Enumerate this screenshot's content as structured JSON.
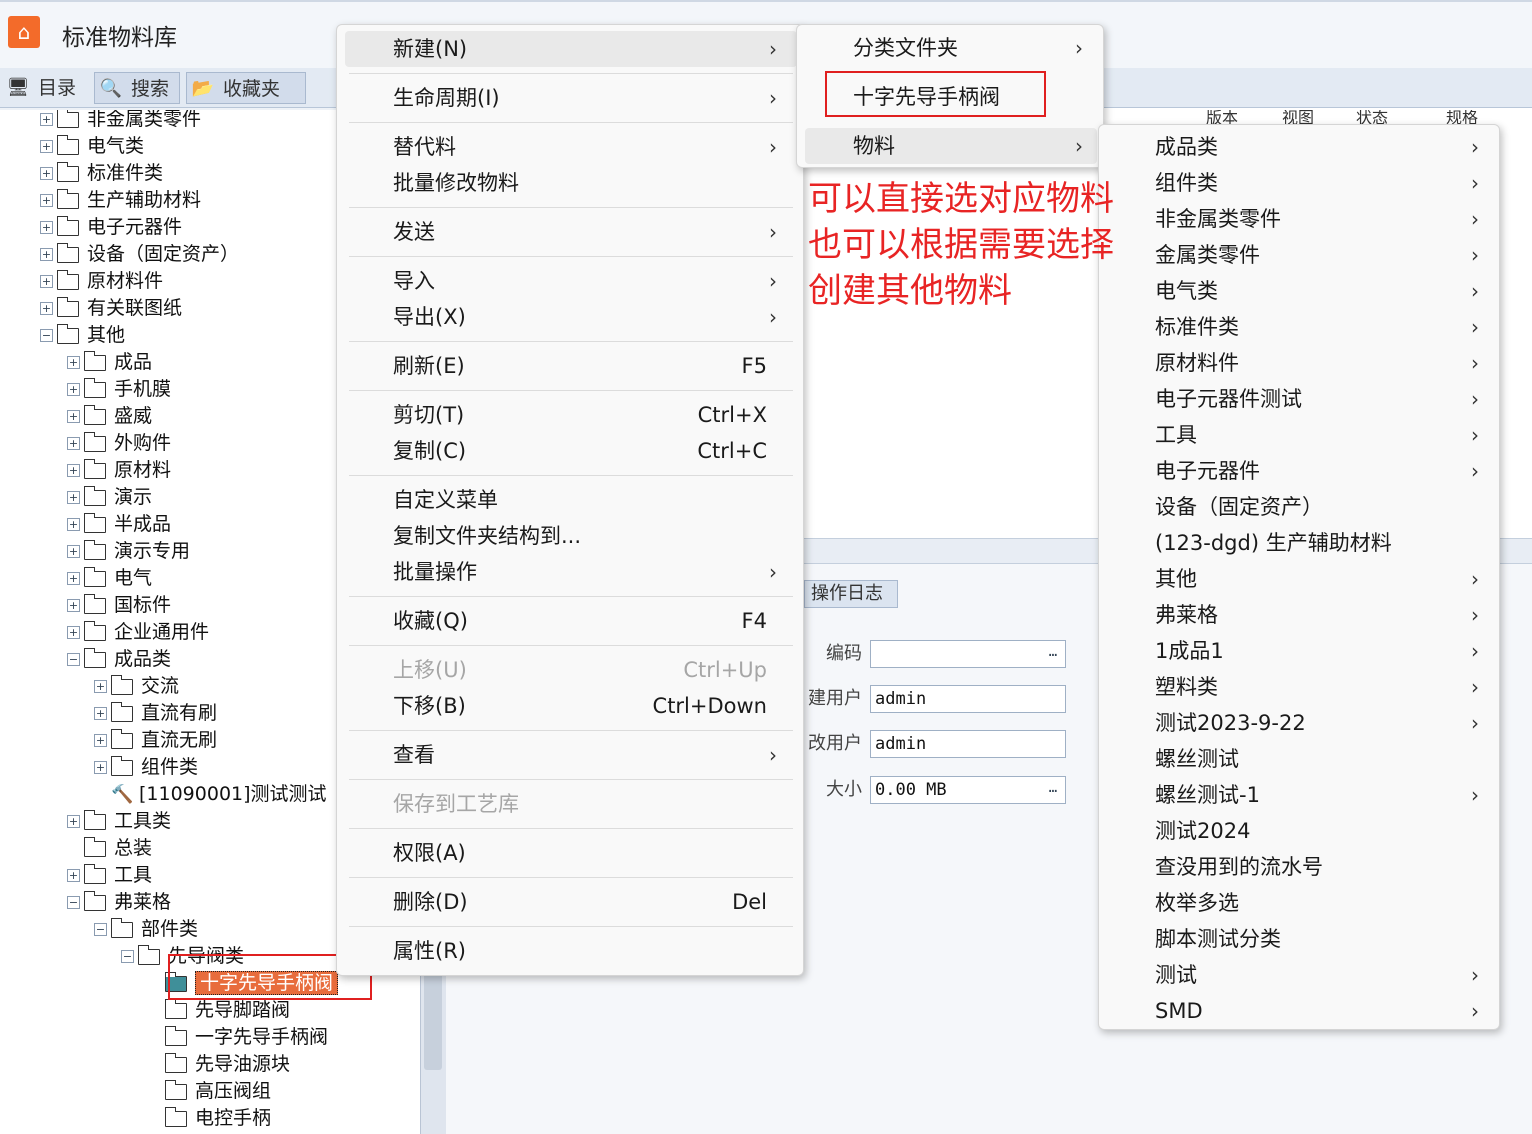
{
  "app": {
    "title": "标准物料库",
    "logo_icon": "home-icon",
    "accent": "#f36b2a"
  },
  "left_tabs": [
    {
      "label": "目录",
      "icon": "monitor-icon"
    },
    {
      "label": "搜索",
      "icon": "search-icon"
    },
    {
      "label": "收藏夹",
      "icon": "folder-star-icon"
    }
  ],
  "tree": [
    {
      "label": "非金属类零件",
      "level": 0,
      "type": "folder",
      "expander": "+"
    },
    {
      "label": "电气类",
      "level": 0,
      "type": "folder",
      "expander": "+"
    },
    {
      "label": "标准件类",
      "level": 0,
      "type": "folder",
      "expander": "+"
    },
    {
      "label": "生产辅助材料",
      "level": 0,
      "type": "folder",
      "expander": "+"
    },
    {
      "label": "电子元器件",
      "level": 0,
      "type": "folder",
      "expander": "+"
    },
    {
      "label": "设备（固定资产）",
      "level": 0,
      "type": "folder",
      "expander": "+"
    },
    {
      "label": "原材料件",
      "level": 0,
      "type": "folder",
      "expander": "+"
    },
    {
      "label": "有关联图纸",
      "level": 0,
      "type": "folder",
      "expander": "+"
    },
    {
      "label": "其他",
      "level": 0,
      "type": "folder",
      "expander": "-"
    },
    {
      "label": "成品",
      "level": 1,
      "type": "folder",
      "expander": "+"
    },
    {
      "label": "手机膜",
      "level": 1,
      "type": "folder",
      "expander": "+"
    },
    {
      "label": "盛威",
      "level": 1,
      "type": "folder",
      "expander": "+"
    },
    {
      "label": "外购件",
      "level": 1,
      "type": "folder",
      "expander": "+"
    },
    {
      "label": "原材料",
      "level": 1,
      "type": "folder",
      "expander": "+"
    },
    {
      "label": "演示",
      "level": 1,
      "type": "folder",
      "expander": "+"
    },
    {
      "label": "半成品",
      "level": 1,
      "type": "folder",
      "expander": "+"
    },
    {
      "label": "演示专用",
      "level": 1,
      "type": "folder",
      "expander": "+"
    },
    {
      "label": "电气",
      "level": 1,
      "type": "folder",
      "expander": "+"
    },
    {
      "label": "国标件",
      "level": 1,
      "type": "folder",
      "expander": "+"
    },
    {
      "label": "企业通用件",
      "level": 1,
      "type": "folder",
      "expander": "+"
    },
    {
      "label": "成品类",
      "level": 1,
      "type": "folder",
      "expander": "-"
    },
    {
      "label": "交流",
      "level": 2,
      "type": "folder",
      "expander": "+"
    },
    {
      "label": "直流有刷",
      "level": 2,
      "type": "folder",
      "expander": "+"
    },
    {
      "label": "直流无刷",
      "level": 2,
      "type": "folder",
      "expander": "+"
    },
    {
      "label": "组件类",
      "level": 2,
      "type": "folder",
      "expander": "+"
    },
    {
      "label": "[11090001]测试测试",
      "level": 2,
      "type": "item",
      "expander": ""
    },
    {
      "label": "工具类",
      "level": 1,
      "type": "folder",
      "expander": "+"
    },
    {
      "label": "总装",
      "level": 1,
      "type": "folder",
      "expander": ""
    },
    {
      "label": "工具",
      "level": 1,
      "type": "folder",
      "expander": "+"
    },
    {
      "label": "弗莱格",
      "level": 1,
      "type": "folder",
      "expander": "-"
    },
    {
      "label": "部件类",
      "level": 2,
      "type": "folder",
      "expander": "-"
    },
    {
      "label": "先导阀类",
      "level": 3,
      "type": "folder",
      "expander": "-"
    },
    {
      "label": "十字先导手柄阀",
      "level": 4,
      "type": "folder",
      "expander": "",
      "selected": true
    },
    {
      "label": "先导脚踏阀",
      "level": 4,
      "type": "folder",
      "expander": ""
    },
    {
      "label": "一字先导手柄阀",
      "level": 4,
      "type": "folder",
      "expander": ""
    },
    {
      "label": "先导油源块",
      "level": 4,
      "type": "folder",
      "expander": ""
    },
    {
      "label": "高压阀组",
      "level": 4,
      "type": "folder",
      "expander": ""
    },
    {
      "label": "电控手柄",
      "level": 4,
      "type": "folder",
      "expander": ""
    }
  ],
  "grid_headers": [
    "版本",
    "视图",
    "状态",
    "规格"
  ],
  "bottom_panel": {
    "tab": "操作日志",
    "fields": [
      {
        "label": "编码",
        "value": "",
        "has_button": true
      },
      {
        "label": "建用户",
        "value": "admin",
        "has_button": false
      },
      {
        "label": "改用户",
        "value": "admin",
        "has_button": false
      },
      {
        "label": "大小",
        "value": "0.00 MB",
        "has_button": true
      }
    ]
  },
  "context_menu": {
    "items": [
      {
        "label": "新建(N)",
        "submenu": true,
        "highlighted": true
      },
      {
        "sep": true
      },
      {
        "label": "生命周期(I)",
        "submenu": true
      },
      {
        "sep": true
      },
      {
        "label": "替代料",
        "submenu": true
      },
      {
        "label": "批量修改物料"
      },
      {
        "sep": true
      },
      {
        "label": "发送",
        "submenu": true
      },
      {
        "sep": true
      },
      {
        "label": "导入",
        "submenu": true
      },
      {
        "label": "导出(X)",
        "submenu": true
      },
      {
        "sep": true
      },
      {
        "label": "刷新(E)",
        "shortcut": "F5"
      },
      {
        "sep": true
      },
      {
        "label": "剪切(T)",
        "shortcut": "Ctrl+X"
      },
      {
        "label": "复制(C)",
        "shortcut": "Ctrl+C"
      },
      {
        "sep": true
      },
      {
        "label": "自定义菜单"
      },
      {
        "label": "复制文件夹结构到..."
      },
      {
        "label": "批量操作",
        "submenu": true
      },
      {
        "sep": true
      },
      {
        "label": "收藏(Q)",
        "shortcut": "F4"
      },
      {
        "sep": true
      },
      {
        "label": "上移(U)",
        "shortcut": "Ctrl+Up",
        "disabled": true
      },
      {
        "label": "下移(B)",
        "shortcut": "Ctrl+Down"
      },
      {
        "sep": true
      },
      {
        "label": "查看",
        "submenu": true
      },
      {
        "sep": true
      },
      {
        "label": "保存到工艺库",
        "disabled": true
      },
      {
        "sep": true
      },
      {
        "label": "权限(A)"
      },
      {
        "sep": true
      },
      {
        "label": "删除(D)",
        "shortcut": "Del"
      },
      {
        "sep": true
      },
      {
        "label": "属性(R)"
      }
    ]
  },
  "new_submenu": {
    "items": [
      {
        "label": "分类文件夹",
        "submenu": true
      },
      {
        "label": "十字先导手柄阀",
        "submenu": false
      },
      {
        "label": "物料",
        "submenu": true,
        "highlighted": true
      }
    ]
  },
  "material_submenu": {
    "items": [
      {
        "label": "成品类",
        "submenu": true
      },
      {
        "label": "组件类",
        "submenu": true
      },
      {
        "label": "非金属类零件",
        "submenu": true
      },
      {
        "label": "金属类零件",
        "submenu": true
      },
      {
        "label": "电气类",
        "submenu": true
      },
      {
        "label": "标准件类",
        "submenu": true
      },
      {
        "label": "原材料件",
        "submenu": true
      },
      {
        "label": "电子元器件测试",
        "submenu": true
      },
      {
        "label": "工具",
        "submenu": true
      },
      {
        "label": "电子元器件",
        "submenu": true
      },
      {
        "label": "设备（固定资产）",
        "submenu": false
      },
      {
        "label": "(123-dgd) 生产辅助材料",
        "submenu": false
      },
      {
        "label": "其他",
        "submenu": true
      },
      {
        "label": "弗莱格",
        "submenu": true
      },
      {
        "label": "1成品1",
        "submenu": true
      },
      {
        "label": "塑料类",
        "submenu": true
      },
      {
        "label": "测试2023-9-22",
        "submenu": true
      },
      {
        "label": "螺丝测试",
        "submenu": false
      },
      {
        "label": "螺丝测试-1",
        "submenu": true
      },
      {
        "label": "测试2024",
        "submenu": false
      },
      {
        "label": "查没用到的流水号",
        "submenu": false
      },
      {
        "label": "枚举多选",
        "submenu": false
      },
      {
        "label": "脚本测试分类",
        "submenu": false
      },
      {
        "label": "测试",
        "submenu": true
      },
      {
        "label": "SMD",
        "submenu": true
      }
    ]
  },
  "annotation": {
    "lines": [
      "可以直接选对应物料",
      "也可以根据需要选择",
      "创建其他物料"
    ],
    "color": "#e82424"
  }
}
